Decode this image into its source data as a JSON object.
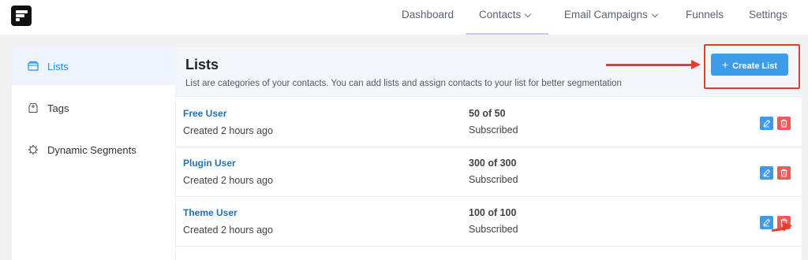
{
  "nav": {
    "items": [
      {
        "label": "Dashboard"
      },
      {
        "label": "Contacts"
      },
      {
        "label": "Email Campaigns"
      },
      {
        "label": "Funnels"
      },
      {
        "label": "Settings"
      }
    ]
  },
  "sidebar": {
    "items": [
      {
        "label": "Lists",
        "icon": "folder-icon",
        "active": true
      },
      {
        "label": "Tags",
        "icon": "tag-icon"
      },
      {
        "label": "Dynamic Segments",
        "icon": "gear-icon"
      }
    ]
  },
  "main": {
    "title": "Lists",
    "subtitle": "List are categories of your contacts. You can add lists and assign contacts to your list for better segmentation",
    "create_button": "Create List"
  },
  "lists": [
    {
      "name": "Free User",
      "created": "Created 2 hours ago",
      "count": "50 of 50",
      "status": "Subscribed"
    },
    {
      "name": "Plugin User",
      "created": "Created 2 hours ago",
      "count": "300 of 300",
      "status": "Subscribed"
    },
    {
      "name": "Theme User",
      "created": "Created 2 hours ago",
      "count": "100 of 100",
      "status": "Subscribed"
    }
  ],
  "colors": {
    "accent": "#3d9be9",
    "delete": "#ee5a5a",
    "annotation": "#e63b2e",
    "link": "#2271b1"
  }
}
